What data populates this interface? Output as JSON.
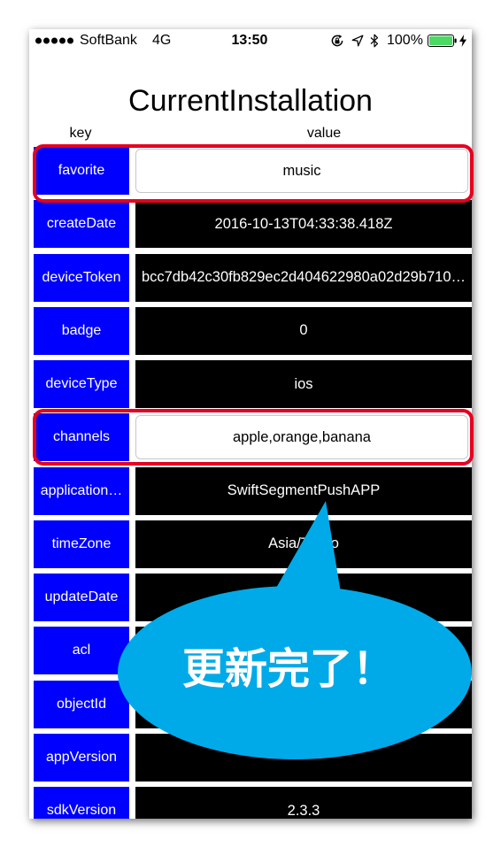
{
  "status_bar": {
    "signal_dots": 5,
    "carrier": "SoftBank",
    "network": "4G",
    "time": "13:50",
    "battery_text": "100%",
    "battery_level": 1.0,
    "battery_color": "#4CD964",
    "icons": {
      "signal": "signal-strength-icon",
      "rotation_lock": "rotation-lock-icon",
      "location": "location-arrow-icon",
      "bluetooth": "bluetooth-icon",
      "battery": "battery-icon",
      "charging": "charging-bolt-icon"
    }
  },
  "title": "CurrentInstallation",
  "table": {
    "header_key": "key",
    "header_value": "value",
    "rows": [
      {
        "key": "favorite",
        "value": "music",
        "highlighted": true
      },
      {
        "key": "createDate",
        "value": "2016-10-13T04:33:38.418Z",
        "highlighted": false
      },
      {
        "key": "deviceToken",
        "value": "bcc7db42c30fb829ec2d404622980a02d29b710…",
        "highlighted": false
      },
      {
        "key": "badge",
        "value": "0",
        "highlighted": false
      },
      {
        "key": "deviceType",
        "value": "ios",
        "highlighted": false
      },
      {
        "key": "channels",
        "value": "apple,orange,banana",
        "highlighted": true
      },
      {
        "key": "application…",
        "value": "SwiftSegmentPushAPP",
        "highlighted": false
      },
      {
        "key": "timeZone",
        "value": "Asia/Tokyo",
        "highlighted": false
      },
      {
        "key": "updateDate",
        "value": "",
        "highlighted": false
      },
      {
        "key": "acl",
        "value": "",
        "highlighted": false
      },
      {
        "key": "objectId",
        "value": "",
        "highlighted": false
      },
      {
        "key": "appVersion",
        "value": "",
        "highlighted": false
      },
      {
        "key": "sdkVersion",
        "value": "2.3.3",
        "highlighted": false
      }
    ]
  },
  "callout": {
    "text": "更新完了！",
    "color": "#00AAE8",
    "text_color": "#FFFFFF"
  },
  "colors": {
    "key_cell": "#0000FF",
    "value_cell": "#000000",
    "field_cell": "#FFFFFF",
    "highlight_border": "#E60020"
  }
}
